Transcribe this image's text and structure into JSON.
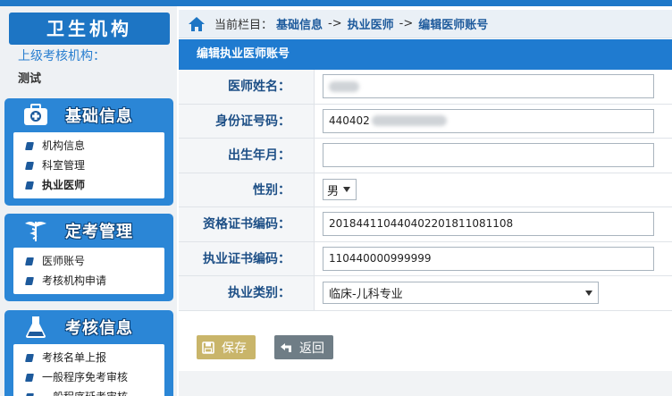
{
  "sidebar": {
    "org_title": "卫生机构",
    "org_label": "上级考核机构：",
    "org_value": "测试",
    "panels": [
      {
        "title": "基础信息",
        "icon": "medical-kit-icon",
        "items": [
          "机构信息",
          "科室管理",
          "执业医师"
        ],
        "active": 2
      },
      {
        "title": "定考管理",
        "icon": "caduceus-icon",
        "items": [
          "医师账号",
          "考核机构申请"
        ]
      },
      {
        "title": "考核信息",
        "icon": "flask-icon",
        "items": [
          "考核名单上报",
          "一般程序免考审核",
          "一般程序延考审核"
        ]
      }
    ]
  },
  "breadcrumb": {
    "label": "当前栏目：",
    "parts": [
      "基础信息",
      "执业医师",
      "编辑医师账号"
    ],
    "sep": "->"
  },
  "form": {
    "title": "编辑执业医师账号",
    "fields": {
      "name": {
        "label": "医师姓名：",
        "value": ""
      },
      "id": {
        "label": "身份证号码：",
        "value": "440402"
      },
      "birth": {
        "label": "出生年月：",
        "value": ""
      },
      "gender": {
        "label": "性别：",
        "value": "男"
      },
      "qual": {
        "label": "资格证书编码：",
        "value": "201844110440402201811081108"
      },
      "cert": {
        "label": "执业证书编码：",
        "value": "110440000999999"
      },
      "type": {
        "label": "执业类别：",
        "value": "临床-儿科专业"
      }
    }
  },
  "buttons": {
    "save": "保存",
    "back": "返回"
  },
  "colors": {
    "accent": "#1f7bd0",
    "sidebar_panel": "#2b86d6",
    "save": "#c9b56a",
    "back": "#6f7d86"
  }
}
